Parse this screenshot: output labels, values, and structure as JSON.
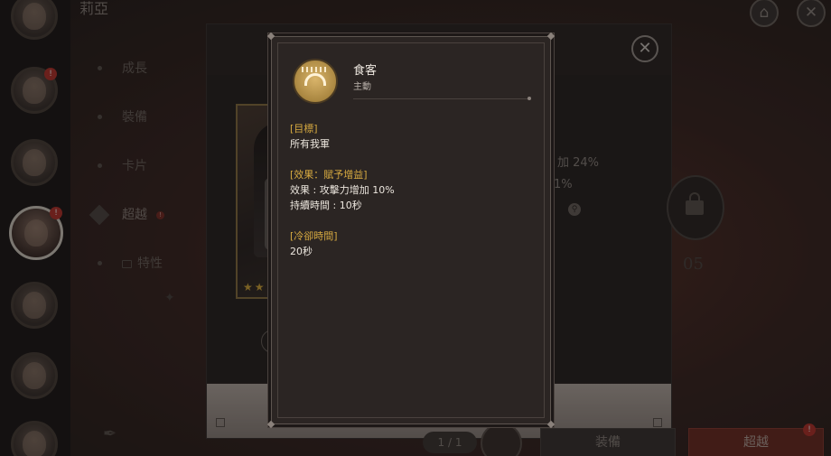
{
  "header": {
    "title": "莉亞"
  },
  "top_buttons": {
    "home_icon": "home-icon",
    "close_icon": "close-icon"
  },
  "menu": {
    "items": [
      {
        "label": "成長"
      },
      {
        "label": "裝備"
      },
      {
        "label": "卡片"
      },
      {
        "label": "超越",
        "badge": "!"
      },
      {
        "label": "特性"
      }
    ]
  },
  "characters": {
    "badges": [
      "!",
      "!"
    ]
  },
  "background_panel": {
    "stats": [
      {
        "text": "加 24%"
      },
      {
        "text": "1%"
      }
    ],
    "medal_number": "05",
    "page_indicator": "1 / 1",
    "buttons": {
      "gear": "装備",
      "transcend": "超越",
      "transcend_badge": "!"
    }
  },
  "tooltip": {
    "skill_name": "食客",
    "skill_type": "主動",
    "sections": [
      {
        "heading": "[目標]",
        "lines": [
          "所有我軍"
        ]
      },
      {
        "heading": "[效果：賦予增益]",
        "lines": [
          "效果 : 攻擊力增加 10%",
          "持續時間 : 10秒"
        ]
      },
      {
        "heading": "[冷卻時間]",
        "lines": [
          "20秒"
        ]
      }
    ]
  },
  "colors": {
    "accent_gold": "#d6a940",
    "badge_red": "#b8322a",
    "tooltip_bg": "#2b2523"
  }
}
